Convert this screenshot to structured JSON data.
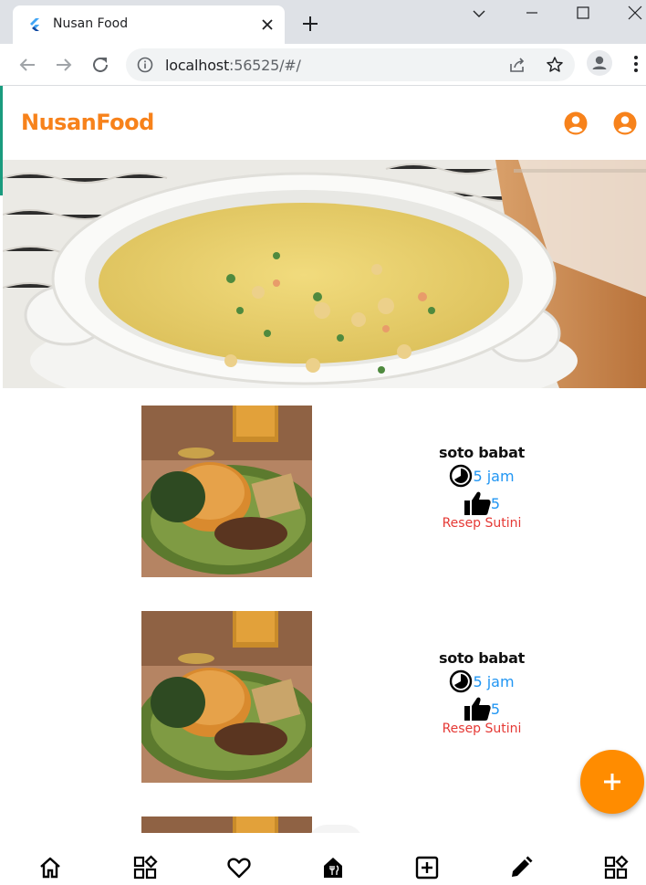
{
  "browser": {
    "tab_title": "Nusan Food",
    "url_host": "localhost",
    "url_rest": ":56525/#/"
  },
  "app": {
    "title": "NusanFood",
    "accent": "#f7821b",
    "header_icons": [
      "account-circle-icon",
      "account-circle-icon"
    ]
  },
  "hero": {
    "image": "bowl-of-soup-photo"
  },
  "recipes": [
    {
      "title": "soto babat",
      "duration": "5 jam",
      "likes": "5",
      "author": "Resep Sutini"
    },
    {
      "title": "soto babat",
      "duration": "5 jam",
      "likes": "5",
      "author": "Resep Sutini"
    }
  ],
  "fab": {
    "icon": "plus-icon",
    "color": "#ff8c00"
  },
  "bottom_nav": {
    "items": [
      "home-icon",
      "category-icon",
      "favorite-icon",
      "restaurant-icon",
      "add-box-icon",
      "edit-icon",
      "category-icon"
    ]
  }
}
